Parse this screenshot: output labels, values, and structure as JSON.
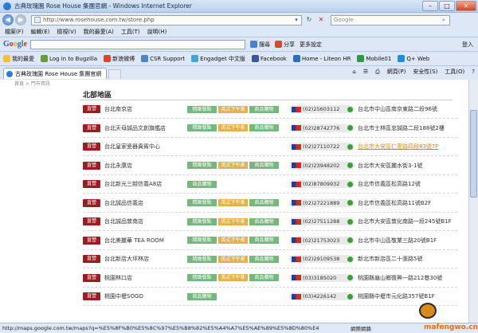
{
  "window": {
    "title": "古典玫瑰園 Rose House 集團官網 - Windows Internet Explorer"
  },
  "address": {
    "url": "http://www.rosehouse.com.tw/store.php",
    "search_placeholder": "Google"
  },
  "menu": [
    "檔案(F)",
    "編輯(E)",
    "檢視(V)",
    "我的最愛(A)",
    "工具(T)",
    "說明(H)"
  ],
  "google_toolbar": {
    "search_label": "搜尋",
    "share_label": "分享",
    "more_label": "更多設定",
    "signin_label": "登入"
  },
  "favorites": [
    "我的最愛",
    "Log in to Bugzilla",
    "新浪微博",
    "CSR Support",
    "Engadget 中文版",
    "Facebook",
    "Home - Liteon HR",
    "Mobile01",
    "Q+ Web"
  ],
  "tab": {
    "title": "古典玫瑰園 Rose House 集團官網"
  },
  "commands": [
    "網頁(P)",
    "安全性(S)",
    "工具(O)"
  ],
  "page": {
    "breadcrumb": "首頁 > 門市資訊",
    "region_title": "北部地區",
    "badge_label": "直營",
    "stores": [
      {
        "name": "台北南京店",
        "services": [
          "精緻餐點",
          "英式下午茶",
          "商品購物"
        ],
        "phone": "(02)25603112",
        "address": "台北市中山區南京東路二段96號",
        "highlight": false
      },
      {
        "name": "台北天母誠品文創旗艦店",
        "services": [
          "精緻餐點",
          "英式下午茶",
          "商品購物"
        ],
        "phone": "(02)28742776",
        "address": "台北市士林區忠誠路二段188號2樓",
        "highlight": false
      },
      {
        "name": "台北皇家瓷器貴賓中心",
        "services": [],
        "phone": "(02)27110722",
        "address": "台北市大安區仁愛路四段83號7F",
        "highlight": true
      },
      {
        "name": "台北永康店",
        "services": [
          "精緻餐點",
          "英式下午茶",
          "商品購物"
        ],
        "phone": "(02)23948202",
        "address": "台北市大安區麗水街3-1號",
        "highlight": false
      },
      {
        "name": "台北新光三越信義A8店",
        "services": [
          "商品購物"
        ],
        "phone": "(02)87809932",
        "address": "台北市信義區松高路12號",
        "highlight": false
      },
      {
        "name": "台北誠品信義店",
        "services": [
          "精緻餐點",
          "英式下午茶",
          "商品購物"
        ],
        "phone": "(02)27221889",
        "address": "台北市信義區松高路11號B2F",
        "highlight": false
      },
      {
        "name": "台北誠品敦南店",
        "services": [
          "精緻餐點",
          "英式下午茶",
          "商品購物"
        ],
        "phone": "(02)27511288",
        "address": "台北市大安區敦化南路一段245號B1F",
        "highlight": false
      },
      {
        "name": "台北美麗華 TEA ROOM",
        "services": [
          "精緻餐點",
          "英式下午茶",
          "商品購物"
        ],
        "phone": "(02)21753023",
        "address": "台北市中山區敬業三路20號B1F",
        "highlight": false
      },
      {
        "name": "台北新店大坪林店",
        "services": [
          "精緻餐點",
          "英式下午茶",
          "商品購物"
        ],
        "phone": "(02)29109538",
        "address": "新北市新店區二十張路5號",
        "highlight": false
      },
      {
        "name": "桃園林口店",
        "services": [
          "精緻餐點",
          "英式下午茶",
          "商品購物"
        ],
        "phone": "(03)3185020",
        "address": "桃園縣龜山鄉復興一路212巷30號",
        "highlight": false
      },
      {
        "name": "桃園中壢SOGO",
        "services": [
          "商品購物"
        ],
        "phone": "(03)4226142",
        "address": "桃園縣中壢市元化路357號B1F",
        "highlight": false
      }
    ]
  },
  "status": {
    "text": "http://maps.google.com.tw/maps?q=%E5%8F%B0%E5%8C%97%E5%B8%82%E5%A4%A7%E5%AE%89%E5%8D%80%E4",
    "zone": "網際網路",
    "watermark": "mafengwo.cn"
  },
  "colors": {
    "badge": "#9b1c21",
    "svc_green": "#74b87d",
    "svc_orange": "#e3b24e",
    "highlight_link": "#d58a10"
  }
}
